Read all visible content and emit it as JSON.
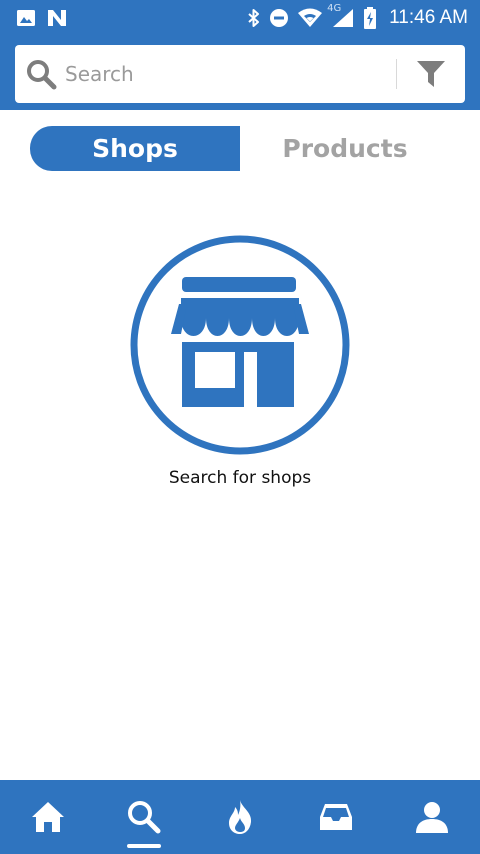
{
  "status_bar": {
    "time": "11:46 AM",
    "network_type": "4G",
    "icons": [
      "image-icon",
      "notification-n-icon",
      "bluetooth-icon",
      "do-not-disturb-icon",
      "wifi-icon",
      "cell-signal-icon",
      "battery-charging-icon"
    ]
  },
  "search": {
    "placeholder": "Search",
    "value": "",
    "filter_icon": "filter-funnel-icon"
  },
  "tabs": {
    "shops": "Shops",
    "products": "Products",
    "active": "shops"
  },
  "empty_state": {
    "icon": "storefront-icon",
    "message": "Search for shops"
  },
  "bottom_nav": {
    "items": [
      {
        "icon": "home-icon"
      },
      {
        "icon": "search-icon",
        "active": true
      },
      {
        "icon": "flame-icon"
      },
      {
        "icon": "inbox-icon"
      },
      {
        "icon": "profile-icon"
      }
    ]
  },
  "colors": {
    "primary": "#2f74bf",
    "inactive_tab_text": "#a3a3a3",
    "background": "#ffffff"
  }
}
